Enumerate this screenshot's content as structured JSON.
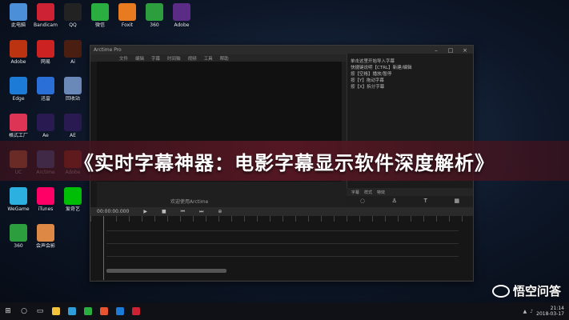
{
  "banner": {
    "title": "《实时字幕神器：电影字幕显示软件深度解析》"
  },
  "watermark": {
    "text": "悟空问答"
  },
  "window": {
    "title": "Arctime Pro",
    "menu": [
      "文件",
      "编辑",
      "字幕",
      "时间轴",
      "视频",
      "工具",
      "帮助"
    ],
    "right_panel_lines": [
      "单击这里开始导入字幕",
      "快捷键说明【CTRL】新建/编辑",
      "按【空格】播放/暂停",
      "按【Y】拖动字幕",
      "按【X】拆分字幕"
    ],
    "subbar": [
      "字幕",
      "样式",
      "特效"
    ],
    "welcome": "欢迎使用Arctime",
    "timecode": "00:00:00.000"
  },
  "icons": [
    {
      "label": "此电脑",
      "color": "#4a8fd8"
    },
    {
      "label": "Bandicam",
      "color": "#c23"
    },
    {
      "label": "QQ",
      "color": "#222"
    },
    {
      "label": "微信",
      "color": "#2aae3f"
    },
    {
      "label": "Foxit",
      "color": "#e87a1f"
    },
    {
      "label": "360",
      "color": "#2c9e3e"
    },
    {
      "label": "Adobe",
      "color": "#5b2c85"
    },
    {
      "label": "Adobe",
      "color": "#b31"
    },
    {
      "label": "网易",
      "color": "#c22"
    },
    {
      "label": "Ai",
      "color": "#4a1f12"
    },
    {
      "label": "Edge",
      "color": "#1c7bd6"
    },
    {
      "label": "迅雷",
      "color": "#2a6fd8"
    },
    {
      "label": "回收站",
      "color": "#6a88b8"
    },
    {
      "label": "格式工厂",
      "color": "#d35"
    },
    {
      "label": "Ae",
      "color": "#2a1a52"
    },
    {
      "label": "AE",
      "color": "#2a1a52"
    },
    {
      "label": "UC",
      "color": "#e74"
    },
    {
      "label": "Arctime",
      "color": "#3c74d2"
    },
    {
      "label": "Adobe",
      "color": "#b31"
    },
    {
      "label": "WeGame",
      "color": "#2cb0e0"
    },
    {
      "label": "iTunes",
      "color": "#f06"
    },
    {
      "label": "爱奇艺",
      "color": "#00be06"
    },
    {
      "label": "360",
      "color": "#2c9e3e"
    },
    {
      "label": "会声会影",
      "color": "#d84"
    }
  ],
  "taskbar": {
    "apps": [
      "#f5c33b",
      "#2f9ed8",
      "#2aae3f",
      "#e8542f",
      "#1c7bd6",
      "#c23"
    ],
    "clock_time": "21:14",
    "clock_date": "2018-03-17"
  }
}
